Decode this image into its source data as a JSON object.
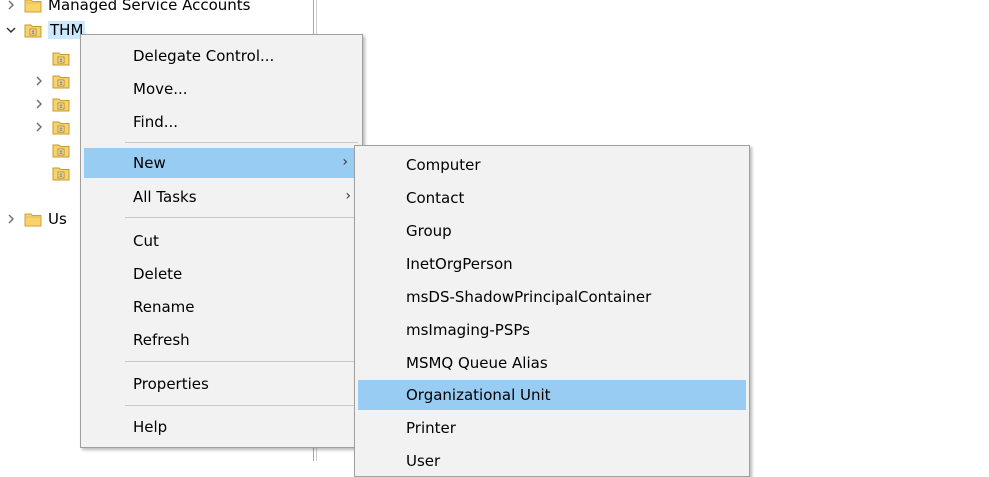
{
  "tree": {
    "items": [
      {
        "label": "Managed Service Accounts"
      },
      {
        "label": "THM"
      },
      {
        "label": "Us"
      }
    ]
  },
  "context_menu": {
    "items": [
      {
        "label": "Delegate Control..."
      },
      {
        "label": "Move..."
      },
      {
        "label": "Find..."
      },
      {
        "label": "New",
        "highlighted": true
      },
      {
        "label": "All Tasks"
      },
      {
        "label": "Cut"
      },
      {
        "label": "Delete"
      },
      {
        "label": "Rename"
      },
      {
        "label": "Refresh"
      },
      {
        "label": "Properties"
      },
      {
        "label": "Help"
      }
    ]
  },
  "submenu_new": {
    "items": [
      {
        "label": "Computer"
      },
      {
        "label": "Contact"
      },
      {
        "label": "Group"
      },
      {
        "label": "InetOrgPerson"
      },
      {
        "label": "msDS-ShadowPrincipalContainer"
      },
      {
        "label": "msImaging-PSPs"
      },
      {
        "label": "MSMQ Queue Alias"
      },
      {
        "label": "Organizational Unit",
        "highlighted": true
      },
      {
        "label": "Printer"
      },
      {
        "label": "User"
      }
    ]
  },
  "icons": {
    "folder": "folder-icon",
    "ou_folder": "ou-folder-icon",
    "chevron_right": "chevron-right-icon",
    "chevron_down": "chevron-down-icon",
    "submenu_arrow": "submenu-arrow-icon"
  },
  "colors": {
    "menu_highlight": "#99ccf3",
    "tree_selection": "#cce8ff",
    "menu_background": "#f2f2f2"
  }
}
